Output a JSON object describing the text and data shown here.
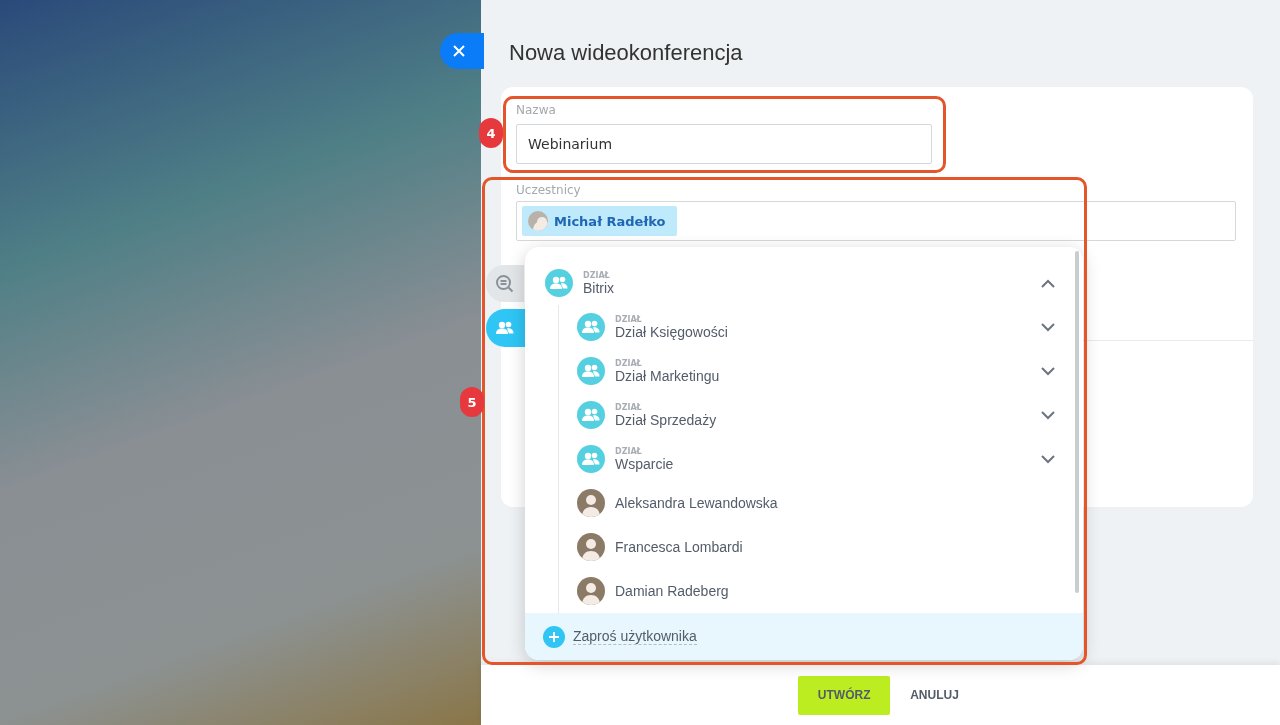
{
  "title": "Nowa wideokonferencja",
  "name_field": {
    "label": "Nazwa",
    "value": "Webinarium"
  },
  "participants": {
    "label": "Uczestnicy",
    "chips": [
      {
        "name": "Michał Radełko"
      }
    ]
  },
  "side_tabs": [
    {
      "kind": "search",
      "selected": false
    },
    {
      "kind": "users",
      "selected": true
    }
  ],
  "dropdown": {
    "items": [
      {
        "kind": "department",
        "type_label": "DZIAŁ",
        "name": "Bitrix",
        "expanded": true,
        "children": [
          {
            "kind": "department",
            "type_label": "DZIAŁ",
            "name": "Dział Księgowości",
            "expanded": false
          },
          {
            "kind": "department",
            "type_label": "DZIAŁ",
            "name": "Dział Marketingu",
            "expanded": false
          },
          {
            "kind": "department",
            "type_label": "DZIAŁ",
            "name": "Dział Sprzedaży",
            "expanded": false
          },
          {
            "kind": "department",
            "type_label": "DZIAŁ",
            "name": "Wsparcie",
            "expanded": false
          },
          {
            "kind": "user",
            "name": "Aleksandra Lewandowska"
          },
          {
            "kind": "user",
            "name": "Francesca Lombardi"
          },
          {
            "kind": "user",
            "name": "Damian Radeberg"
          }
        ]
      }
    ],
    "footer_link": "Zaproś użytkownika"
  },
  "buttons": [
    {
      "kind": "primary",
      "label": "UTWÓRZ"
    },
    {
      "kind": "plain",
      "label": "ANULUJ"
    }
  ],
  "annotations": [
    {
      "label": "4"
    },
    {
      "label": "5"
    }
  ]
}
